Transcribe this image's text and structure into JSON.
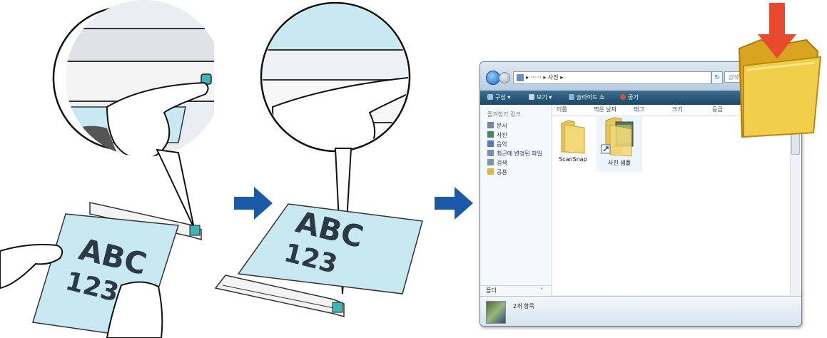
{
  "illustration": {
    "paper_left_text": [
      "ABC",
      "123"
    ],
    "paper_right_text": [
      "ABC",
      "123"
    ],
    "arrow_color": "#1a5aa8",
    "drop_arrow_color": "#e84a2e"
  },
  "explorer": {
    "address": {
      "path_user": "▸ ······",
      "path_folder": "▸ 사진 ▸",
      "search_placeholder": "검색",
      "refresh_label": "↻"
    },
    "toolbar": {
      "organize": "구성 ▾",
      "view": "보기 ▾",
      "slideshow": "슬라이드 쇼",
      "burn": "굽기"
    },
    "nav": {
      "header": "즐겨찾기 링크",
      "items": [
        {
          "label": "문서",
          "color": "#6f86a6"
        },
        {
          "label": "사진",
          "color": "#3f8a5a"
        },
        {
          "label": "음악",
          "color": "#4d7cc0"
        },
        {
          "label": "최근에 변경된 파일",
          "color": "#7a8fb0"
        },
        {
          "label": "검색",
          "color": "#7f93ad"
        },
        {
          "label": "공용",
          "color": "#e0b93c"
        }
      ],
      "folders_label": "폴더",
      "folders_chevron": "˄"
    },
    "columns": [
      "이름",
      "찍은 날짜",
      "태그",
      "크기",
      "등급"
    ],
    "files": [
      {
        "name": "ScanSnap",
        "type": "folder"
      },
      {
        "name": "사진 샘플",
        "type": "shortcut-folder"
      }
    ],
    "details": {
      "item_count": "2개 항목"
    }
  }
}
